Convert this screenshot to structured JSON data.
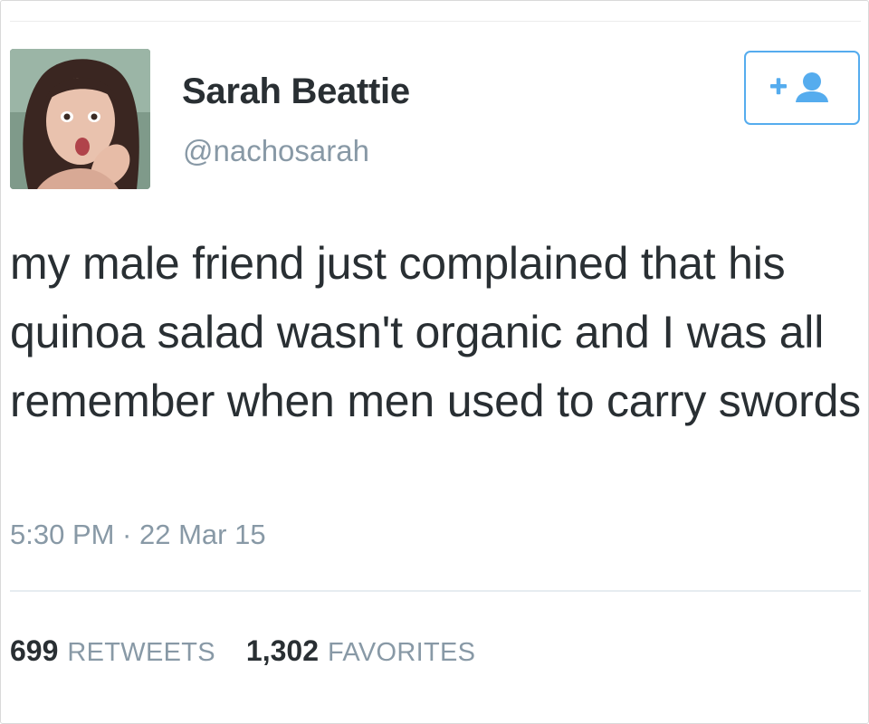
{
  "author": {
    "display_name": "Sarah Beattie",
    "handle": "@nachosarah",
    "avatar_icon": "profile-photo"
  },
  "follow_button": {
    "icon": "add-user-icon",
    "accent_color": "#55acee"
  },
  "tweet": {
    "text": "my male friend just complained that his quinoa salad wasn't organic and I was all remember when men used to carry swords",
    "timestamp": "5:30 PM · 22 Mar 15"
  },
  "stats": {
    "retweets_count": "699",
    "retweets_label": "RETWEETS",
    "favorites_count": "1,302",
    "favorites_label": "FAVORITES"
  },
  "colors": {
    "text": "#292f33",
    "muted": "#8899a6",
    "divider": "#e6ecf0"
  }
}
